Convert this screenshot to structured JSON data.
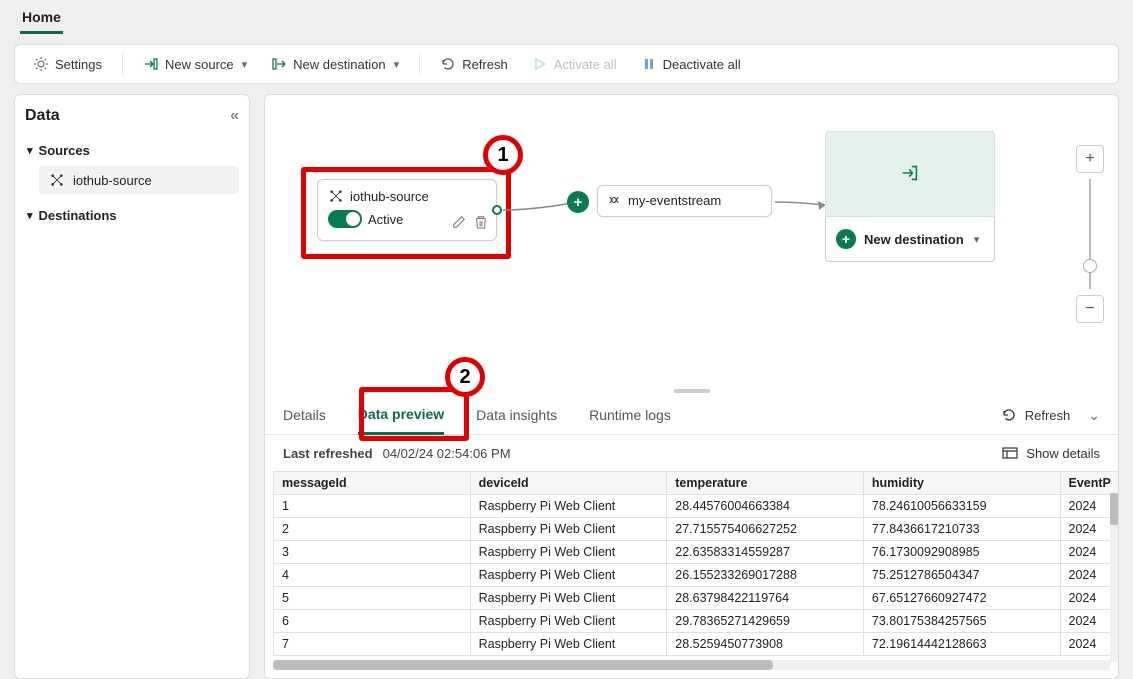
{
  "topTab": "Home",
  "toolbar": {
    "settings": "Settings",
    "newSource": "New source",
    "newDestination": "New destination",
    "refresh": "Refresh",
    "activateAll": "Activate all",
    "deactivateAll": "Deactivate all"
  },
  "sidebar": {
    "title": "Data",
    "groups": {
      "sources": "Sources",
      "destinations": "Destinations"
    },
    "sourceItem": "iothub-source"
  },
  "canvas": {
    "sourceNode": {
      "title": "iothub-source",
      "status": "Active"
    },
    "streamNode": {
      "title": "my-eventstream"
    },
    "newDestination": "New destination"
  },
  "annotation": {
    "one": "1",
    "two": "2"
  },
  "bottomTabs": {
    "details": "Details",
    "dataPreview": "Data preview",
    "dataInsights": "Data insights",
    "runtimeLogs": "Runtime logs",
    "refresh": "Refresh"
  },
  "meta": {
    "lastRefreshedLabel": "Last refreshed",
    "lastRefreshedValue": "04/02/24 02:54:06 PM",
    "showDetails": "Show details"
  },
  "table": {
    "headers": {
      "messageId": "messageId",
      "deviceId": "deviceId",
      "temperature": "temperature",
      "humidity": "humidity",
      "eventP": "EventP"
    },
    "rows": [
      {
        "messageId": "1",
        "deviceId": "Raspberry Pi Web Client",
        "temperature": "28.44576004663384",
        "humidity": "78.24610056633159",
        "eventP": "2024"
      },
      {
        "messageId": "2",
        "deviceId": "Raspberry Pi Web Client",
        "temperature": "27.715575406627252",
        "humidity": "77.8436617210733",
        "eventP": "2024"
      },
      {
        "messageId": "3",
        "deviceId": "Raspberry Pi Web Client",
        "temperature": "22.63583314559287",
        "humidity": "76.1730092908985",
        "eventP": "2024"
      },
      {
        "messageId": "4",
        "deviceId": "Raspberry Pi Web Client",
        "temperature": "26.155233269017288",
        "humidity": "75.2512786504347",
        "eventP": "2024"
      },
      {
        "messageId": "5",
        "deviceId": "Raspberry Pi Web Client",
        "temperature": "28.63798422119764",
        "humidity": "67.65127660927472",
        "eventP": "2024"
      },
      {
        "messageId": "6",
        "deviceId": "Raspberry Pi Web Client",
        "temperature": "29.78365271429659",
        "humidity": "73.80175384257565",
        "eventP": "2024"
      },
      {
        "messageId": "7",
        "deviceId": "Raspberry Pi Web Client",
        "temperature": "28.5259450773908",
        "humidity": "72.19614442128663",
        "eventP": "2024"
      }
    ]
  }
}
